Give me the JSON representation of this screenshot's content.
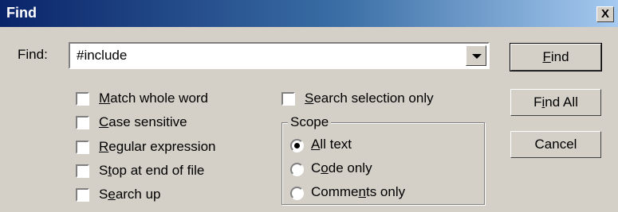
{
  "window": {
    "title": "Find",
    "close_label": "X"
  },
  "find_label": "Find:",
  "search": {
    "value": "#include"
  },
  "buttons": {
    "find": {
      "pre": "",
      "u": "F",
      "post": "ind"
    },
    "find_all": {
      "pre": "F",
      "u": "i",
      "post": "nd All"
    },
    "cancel": "Cancel"
  },
  "options": [
    {
      "pre": "",
      "u": "M",
      "post": "atch whole word",
      "checked": false
    },
    {
      "pre": "",
      "u": "C",
      "post": "ase sensitive",
      "checked": false
    },
    {
      "pre": "",
      "u": "R",
      "post": "egular expression",
      "checked": false
    },
    {
      "pre": "S",
      "u": "t",
      "post": "op at end of file",
      "checked": false
    },
    {
      "pre": "S",
      "u": "e",
      "post": "arch up",
      "checked": false
    }
  ],
  "search_selection": {
    "pre": "",
    "u": "S",
    "post": "earch selection only",
    "checked": false
  },
  "scope": {
    "label": "Scope",
    "options": [
      {
        "pre": "",
        "u": "A",
        "post": "ll text",
        "selected": true
      },
      {
        "pre": "C",
        "u": "o",
        "post": "de only",
        "selected": false
      },
      {
        "pre": "Comme",
        "u": "n",
        "post": "ts only",
        "selected": false
      }
    ]
  }
}
